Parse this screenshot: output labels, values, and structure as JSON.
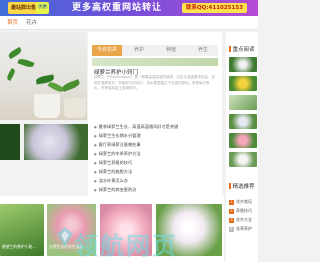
{
  "banner": {
    "badge": "最站群出售",
    "badge2": "优惠",
    "headline": "更多高权重网站转让",
    "contact": "联系QQ:411025153"
  },
  "nav": {
    "items": [
      "首页",
      "花卉"
    ]
  },
  "tabs": [
    "今日花卉",
    "养护",
    "种植",
    "养生"
  ],
  "card": {
    "title": "绿萝兰养护小窍门",
    "desc": "绿萝兰（Phalaenopsis）是一种喜高温高湿的植物，对生长温度要求较高，宜放在通风良好、有散射光的地方。浇水要遵循见干见湿的原则，夏季每天喷水，冬季保持盆土湿润即可。"
  },
  "list": [
    "夏季绿萝兰生长，高温高湿通风好才是关键",
    "绿萝兰生长期水分管理",
    "客厅养绿萝注意哪些事",
    "绿萝兰的冬季养护方法",
    "绿萝兰养殖的技巧",
    "绿萝兰的施肥方法",
    "浇水叶黄怎么办",
    "绿萝兰的病虫害防治"
  ],
  "side": {
    "title": "重点阅读",
    "title2": "精选推荐",
    "ranks": [
      "花卉栽培",
      "养殖技巧",
      "花卉大全",
      "花草养护"
    ],
    "rank_numbers": [
      "1",
      "2",
      "3",
      "4"
    ]
  },
  "gallery": {
    "captions": [
      "鹤望兰的养护小秘...",
      "自然生长的花艺搭配"
    ]
  },
  "watermark": "领航网页"
}
